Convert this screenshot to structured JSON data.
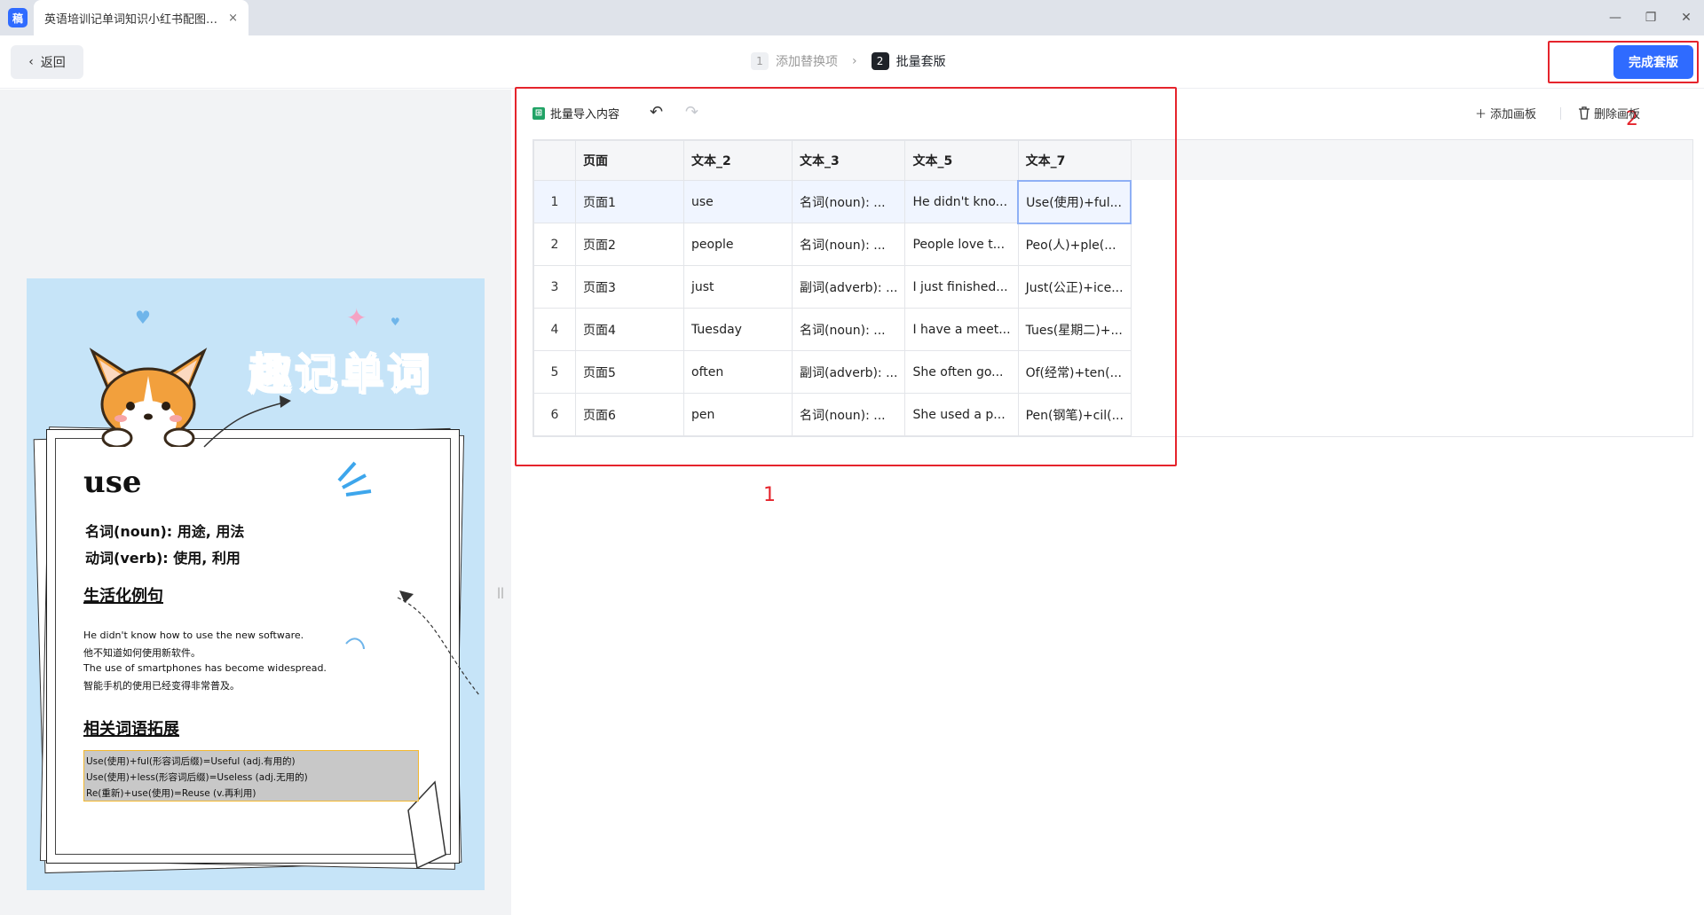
{
  "window": {
    "app_logo": "稿",
    "tab_title": "英语培训记单词知识小红书配图_...",
    "tab_close": "×",
    "controls": {
      "minimize": "—",
      "restore": "❐",
      "close": "✕"
    }
  },
  "header": {
    "back_label": "返回",
    "steps": [
      {
        "num": "1",
        "label": "添加替换项",
        "active": false
      },
      {
        "num": "2",
        "label": "批量套版",
        "active": true
      }
    ],
    "finish_label": "完成套版"
  },
  "annotations": {
    "box1_label": "1",
    "box2_label": "2",
    "color": "#e5242c"
  },
  "poster": {
    "title": "趣记单词",
    "word": "use",
    "definitions": [
      "名词(noun): 用途, 用法",
      "动词(verb): 使用, 利用"
    ],
    "section1": "生活化例句",
    "sentences": [
      "He didn't know how to use the new software.",
      "他不知道如何使用新软件。",
      "The use of smartphones has become widespread.",
      "智能手机的使用已经变得非常普及。"
    ],
    "section2": "相关词语拓展",
    "expansions": [
      "Use(使用)+ful(形容词后缀)=Useful (adj.有用的)",
      "Use(使用)+less(形容词后缀)=Useless (adj.无用的)",
      "Re(重新)+use(使用)=Reuse (v.再利用)"
    ],
    "colors": {
      "background": "#c6e4f8",
      "title": "#3da6ec"
    }
  },
  "toolbar": {
    "import_icon": "excel-icon",
    "import_label": "批量导入内容",
    "undo_icon": "↶",
    "redo_icon": "↷",
    "add_label": "添加画板",
    "delete_label": "删除画板"
  },
  "table": {
    "columns": [
      "页面",
      "文本_2",
      "文本_3",
      "文本_5",
      "文本_7"
    ],
    "rows": [
      {
        "index": "1",
        "cells": [
          "页面1",
          "use",
          "名词(noun): ...",
          "He didn't kno...",
          "Use(使用)+ful..."
        ]
      },
      {
        "index": "2",
        "cells": [
          "页面2",
          "people",
          "名词(noun): ...",
          "People love t...",
          "Peo(人)+ple(..."
        ]
      },
      {
        "index": "3",
        "cells": [
          "页面3",
          "just",
          "副词(adverb): ...",
          "I just finished...",
          "Just(公正)+ice..."
        ]
      },
      {
        "index": "4",
        "cells": [
          "页面4",
          "Tuesday",
          "名词(noun): ...",
          "I have a meet...",
          "Tues(星期二)+..."
        ]
      },
      {
        "index": "5",
        "cells": [
          "页面5",
          "often",
          "副词(adverb): ...",
          "She often go...",
          "Of(经常)+ten(..."
        ]
      },
      {
        "index": "6",
        "cells": [
          "页面6",
          "pen",
          "名词(noun): ...",
          "She used a p...",
          "Pen(钢笔)+cil(..."
        ]
      }
    ]
  }
}
